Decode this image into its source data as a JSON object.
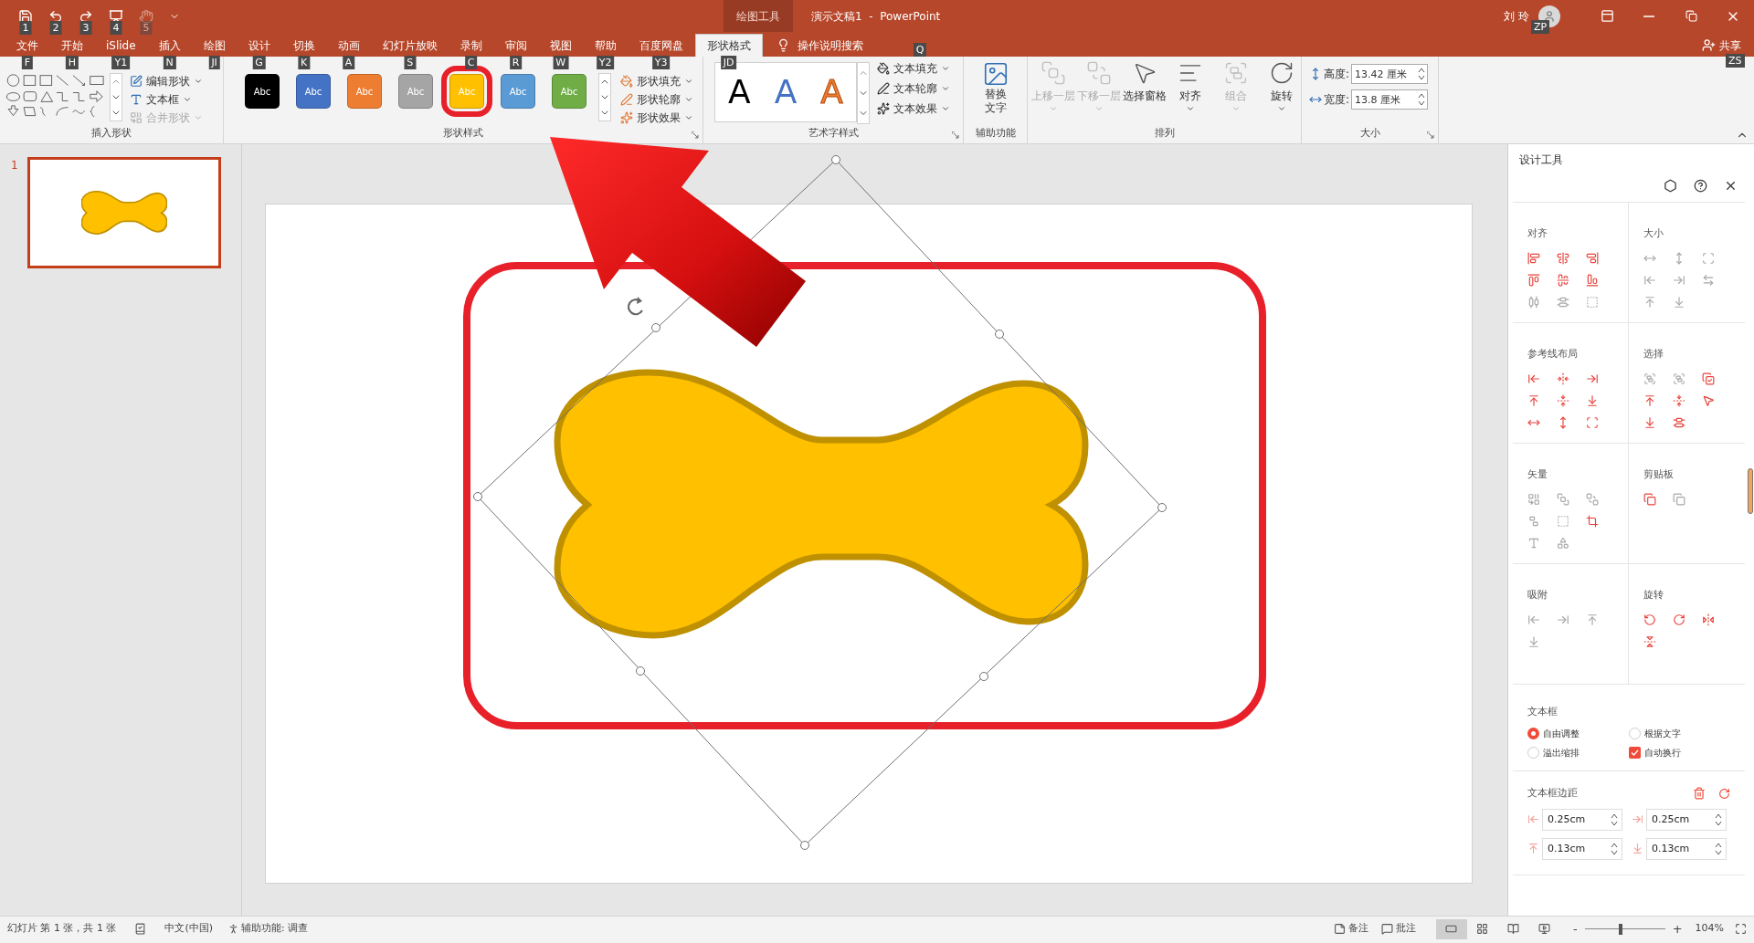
{
  "quick_access": [
    {
      "kind": "save",
      "keytip": "1",
      "enabled": true
    },
    {
      "kind": "undo",
      "keytip": "2",
      "enabled": true
    },
    {
      "kind": "redo",
      "keytip": "3",
      "enabled": true
    },
    {
      "kind": "present",
      "keytip": "4",
      "enabled": true
    },
    {
      "kind": "touch",
      "keytip": "5",
      "enabled": false
    }
  ],
  "window": {
    "context_label": "绘图工具",
    "title": "演示文稿1  -  PowerPoint",
    "user": "刘 玲",
    "user_keytip": "ZP"
  },
  "tabs": [
    {
      "label": "文件",
      "keytip": "F",
      "selected": false
    },
    {
      "label": "开始",
      "keytip": "H",
      "selected": false
    },
    {
      "label": "iSlide",
      "keytip": "Y1",
      "selected": false
    },
    {
      "label": "插入",
      "keytip": "N",
      "selected": false
    },
    {
      "label": "绘图",
      "keytip": "JI",
      "selected": false
    },
    {
      "label": "设计",
      "keytip": "G",
      "selected": false
    },
    {
      "label": "切换",
      "keytip": "K",
      "selected": false
    },
    {
      "label": "动画",
      "keytip": "A",
      "selected": false
    },
    {
      "label": "幻灯片放映",
      "keytip": "S",
      "selected": false
    },
    {
      "label": "录制",
      "keytip": "C",
      "selected": false
    },
    {
      "label": "审阅",
      "keytip": "R",
      "selected": false
    },
    {
      "label": "视图",
      "keytip": "W",
      "selected": false
    },
    {
      "label": "帮助",
      "keytip": "Y2",
      "selected": false
    },
    {
      "label": "百度网盘",
      "keytip": "Y3",
      "selected": false
    },
    {
      "label": "形状格式",
      "keytip": "JD",
      "selected": true
    }
  ],
  "tell_me": {
    "label": "操作说明搜索",
    "keytip": "Q"
  },
  "share": {
    "label": "共享",
    "keytip": "ZS"
  },
  "ribbon": {
    "insert_shapes": {
      "label": "插入形状",
      "commands": [
        {
          "kind": "edit",
          "label": "编辑形状",
          "enabled": true
        },
        {
          "kind": "textbox",
          "label": "文本框",
          "enabled": true
        },
        {
          "kind": "merge",
          "label": "合并形状",
          "enabled": false
        }
      ]
    },
    "shape_styles": {
      "label": "形状样式",
      "swatches": [
        {
          "text": "Abc",
          "color": "#000000",
          "highlighted": false
        },
        {
          "text": "Abc",
          "color": "#4472c4",
          "highlighted": false
        },
        {
          "text": "Abc",
          "color": "#ed7d31",
          "highlighted": false
        },
        {
          "text": "Abc",
          "color": "#a5a5a5",
          "highlighted": false
        },
        {
          "text": "Abc",
          "color": "#ffc000",
          "highlighted": true
        },
        {
          "text": "Abc",
          "color": "#5b9bd5",
          "highlighted": false
        },
        {
          "text": "Abc",
          "color": "#70ad47",
          "highlighted": false
        }
      ],
      "commands": [
        {
          "kind": "fill",
          "label": "形状填充"
        },
        {
          "kind": "outline",
          "label": "形状轮廓"
        },
        {
          "kind": "effects",
          "label": "形状效果"
        }
      ]
    },
    "wordart": {
      "label": "艺术字样式",
      "samples": [
        {
          "text": "A",
          "kind": "solid",
          "color": "#000000"
        },
        {
          "text": "A",
          "kind": "solid",
          "color": "#4472c4"
        },
        {
          "text": "A",
          "kind": "outline",
          "color": "#ed7d31"
        }
      ],
      "commands": [
        {
          "kind": "fill",
          "label": "文本填充"
        },
        {
          "kind": "outline",
          "label": "文本轮廓"
        },
        {
          "kind": "effects",
          "label": "文本效果"
        }
      ]
    },
    "accessibility": {
      "label": "辅助功能",
      "button": "替换文字"
    },
    "arrange": {
      "label": "排列",
      "commands": [
        {
          "kind": "forward",
          "label": "上移一层",
          "enabled": false,
          "dropdown": true
        },
        {
          "kind": "backward",
          "label": "下移一层",
          "enabled": false,
          "dropdown": true
        },
        {
          "kind": "pane",
          "label": "选择窗格",
          "enabled": true,
          "dropdown": false
        },
        {
          "kind": "align",
          "label": "对齐",
          "enabled": true,
          "dropdown": true
        },
        {
          "kind": "group",
          "label": "组合",
          "enabled": false,
          "dropdown": true
        },
        {
          "kind": "rotate",
          "label": "旋转",
          "enabled": true,
          "dropdown": true
        }
      ]
    },
    "size": {
      "label": "大小",
      "fields": [
        {
          "kind": "height",
          "label": "高度:",
          "value": "13.42 厘米"
        },
        {
          "kind": "width",
          "label": "宽度:",
          "value": "13.8 厘米"
        }
      ]
    }
  },
  "slides": [
    {
      "number": "1",
      "selected": true
    }
  ],
  "design_panel": {
    "title": "设计工具",
    "sections": [
      {
        "title": "对齐",
        "tools": [
          {
            "kind": "align-left",
            "enabled": true
          },
          {
            "kind": "align-center",
            "enabled": true
          },
          {
            "kind": "align-right",
            "enabled": true
          },
          {
            "kind": "align-top",
            "enabled": true
          },
          {
            "kind": "align-middle",
            "enabled": true
          },
          {
            "kind": "align-bottom",
            "enabled": true
          },
          {
            "kind": "distribute-horizontal",
            "enabled": false
          },
          {
            "kind": "distribute-vertical",
            "enabled": false
          },
          {
            "kind": "dashed-frame",
            "enabled": false
          }
        ]
      },
      {
        "title": "大小",
        "tools": [
          {
            "kind": "width",
            "enabled": false
          },
          {
            "kind": "height",
            "enabled": false
          },
          {
            "kind": "corners",
            "enabled": false
          },
          {
            "kind": "arrow-left-line",
            "enabled": false
          },
          {
            "kind": "arrow-right-line",
            "enabled": false
          },
          {
            "kind": "swap",
            "enabled": false
          },
          {
            "kind": "arrow-up-line",
            "enabled": false
          },
          {
            "kind": "arrow-down-line",
            "enabled": false
          }
        ]
      },
      {
        "title": "参考线布局",
        "tools": [
          {
            "kind": "arrow-left-line",
            "enabled": true
          },
          {
            "kind": "fold-horizontal",
            "enabled": true
          },
          {
            "kind": "arrow-right-line",
            "enabled": true
          },
          {
            "kind": "arrow-up-line",
            "enabled": true
          },
          {
            "kind": "fold-vertical",
            "enabled": true
          },
          {
            "kind": "arrow-down-line",
            "enabled": true
          },
          {
            "kind": "width",
            "enabled": true
          },
          {
            "kind": "height",
            "enabled": true
          },
          {
            "kind": "corners",
            "enabled": true
          }
        ]
      },
      {
        "title": "选择",
        "tools": [
          {
            "kind": "group",
            "enabled": false
          },
          {
            "kind": "group",
            "enabled": false
          },
          {
            "kind": "copy-check",
            "enabled": true
          },
          {
            "kind": "arrow-up-line",
            "enabled": true
          },
          {
            "kind": "fold-vertical",
            "enabled": true
          },
          {
            "kind": "pointer",
            "enabled": true
          },
          {
            "kind": "arrow-down-line",
            "enabled": true
          },
          {
            "kind": "distribute-vertical",
            "enabled": true
          }
        ]
      },
      {
        "title": "矢量",
        "tools": [
          {
            "kind": "combine",
            "enabled": false
          },
          {
            "kind": "bring-front",
            "enabled": false
          },
          {
            "kind": "send-back",
            "enabled": false
          },
          {
            "kind": "ungroup",
            "enabled": false
          },
          {
            "kind": "dashed-frame",
            "enabled": false
          },
          {
            "kind": "crop",
            "enabled": true
          },
          {
            "kind": "text",
            "enabled": false
          },
          {
            "kind": "shapes",
            "enabled": false
          }
        ]
      },
      {
        "title": "剪贴板",
        "tools": [
          {
            "kind": "copy",
            "enabled": true
          },
          {
            "kind": "copy",
            "enabled": false
          }
        ]
      },
      {
        "title": "吸附",
        "tools": [
          {
            "kind": "arrow-left-line",
            "enabled": false
          },
          {
            "kind": "arrow-right-line",
            "enabled": false
          },
          {
            "kind": "arrow-up-line",
            "enabled": false
          },
          {
            "kind": "arrow-down-line",
            "enabled": false
          }
        ]
      },
      {
        "title": "旋转",
        "tools": [
          {
            "kind": "rotate-left",
            "enabled": true
          },
          {
            "kind": "rotate-right",
            "enabled": true
          },
          {
            "kind": "flip-horizontal",
            "enabled": true
          },
          {
            "kind": "flip-vertical",
            "enabled": true
          }
        ]
      }
    ],
    "textbox": {
      "title": "文本框",
      "options": [
        {
          "kind": "radio",
          "label": "自由调整",
          "checked": true
        },
        {
          "kind": "radio",
          "label": "根据文字",
          "checked": false
        },
        {
          "kind": "radio",
          "label": "溢出缩排",
          "checked": false
        },
        {
          "kind": "checkbox",
          "label": "自动换行",
          "checked": true
        }
      ]
    },
    "margins": {
      "title": "文本框边距",
      "fields": [
        {
          "kind": "left",
          "value": "0.25cm"
        },
        {
          "kind": "right",
          "value": "0.25cm"
        },
        {
          "kind": "top",
          "value": "0.13cm"
        },
        {
          "kind": "bottom",
          "value": "0.13cm"
        }
      ]
    }
  },
  "status_bar": {
    "slide_info": "幻灯片 第 1 张，共 1 张",
    "language": "中文(中国)",
    "accessibility": "辅助功能: 调查",
    "notes": "备注",
    "comments": "批注",
    "views": [
      {
        "kind": "normal",
        "selected": true
      },
      {
        "kind": "sorter",
        "selected": false
      },
      {
        "kind": "reading",
        "selected": false
      },
      {
        "kind": "slideshow",
        "selected": false
      }
    ],
    "zoom": {
      "minus": "-",
      "plus": "+",
      "level": 0.45,
      "reading": "104%"
    }
  }
}
